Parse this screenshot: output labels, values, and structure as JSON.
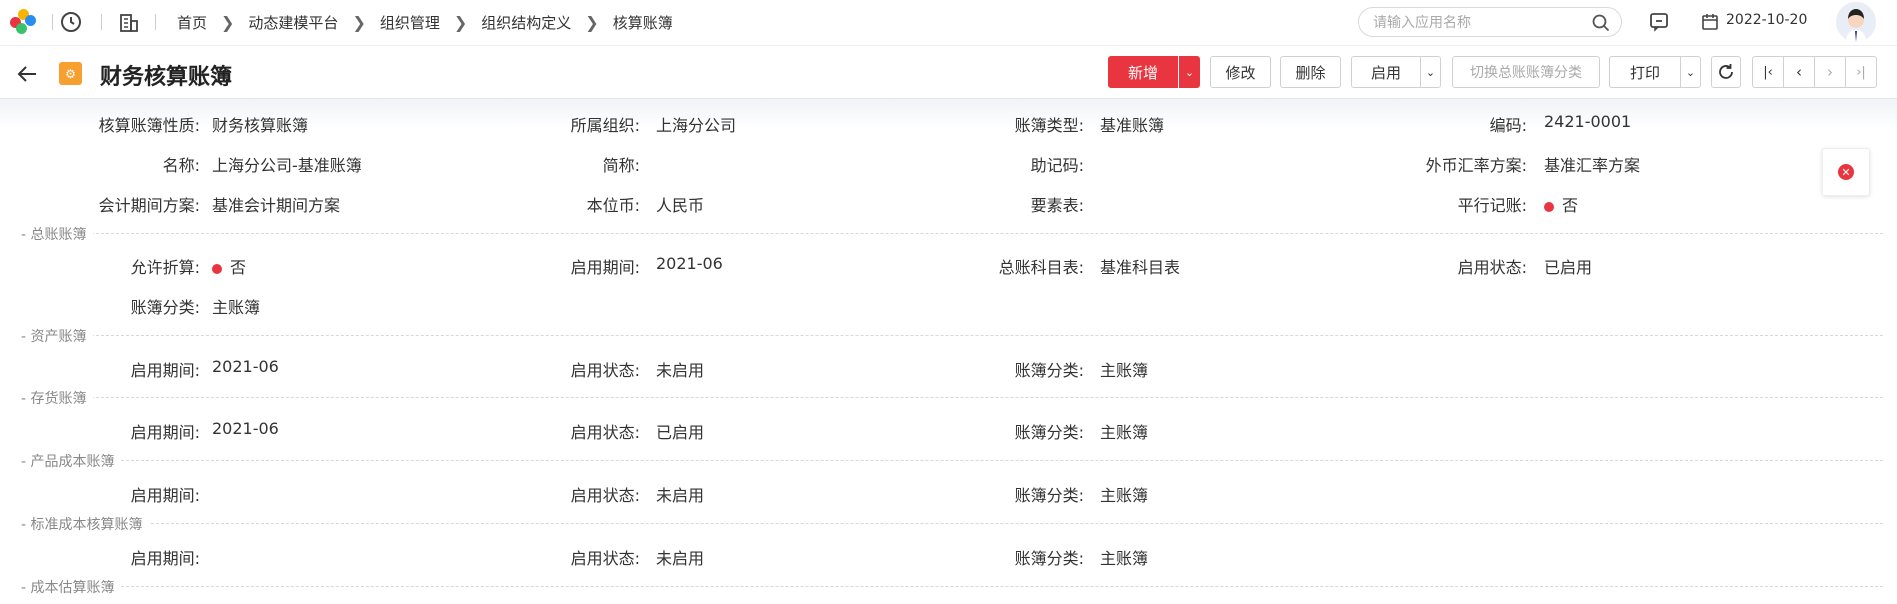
{
  "topbar": {
    "breadcrumb": [
      "首页",
      "动态建模平台",
      "组织管理",
      "组织结构定义",
      "核算账簿"
    ],
    "search_placeholder": "请输入应用名称",
    "date": "2022-10-20"
  },
  "header": {
    "title": "财务核算账簿",
    "buttons": {
      "add": "新增",
      "edit": "修改",
      "delete": "删除",
      "enable": "启用",
      "switch": "切换总账账簿分类",
      "print": "打印"
    }
  },
  "basic": {
    "r1": [
      {
        "label": "核算账簿性质:",
        "value": "财务核算账簿"
      },
      {
        "label": "所属组织:",
        "value": "上海分公司"
      },
      {
        "label": "账簿类型:",
        "value": "基准账簿"
      },
      {
        "label": "编码:",
        "value": "2421-0001"
      }
    ],
    "r2": [
      {
        "label": "名称:",
        "value": "上海分公司-基准账簿"
      },
      {
        "label": "简称:",
        "value": ""
      },
      {
        "label": "助记码:",
        "value": ""
      },
      {
        "label": "外币汇率方案:",
        "value": "基准汇率方案"
      }
    ],
    "r3": [
      {
        "label": "会计期间方案:",
        "value": "基准会计期间方案"
      },
      {
        "label": "本位币:",
        "value": "人民币"
      },
      {
        "label": "要素表:",
        "value": ""
      },
      {
        "label": "平行记账:",
        "value": "否"
      }
    ]
  },
  "sections": {
    "gl": {
      "title": "- 总账账簿",
      "r1": [
        {
          "label": "允许折算:",
          "value": "否"
        },
        {
          "label": "启用期间:",
          "value": "2021-06"
        },
        {
          "label": "总账科目表:",
          "value": "基准科目表"
        },
        {
          "label": "启用状态:",
          "value": "已启用"
        }
      ],
      "r2": [
        {
          "label": "账簿分类:",
          "value": "主账簿"
        }
      ]
    },
    "asset": {
      "title": "- 资产账簿",
      "r1": [
        {
          "label": "启用期间:",
          "value": "2021-06"
        },
        {
          "label": "启用状态:",
          "value": "未启用"
        },
        {
          "label": "账簿分类:",
          "value": "主账簿"
        }
      ]
    },
    "inventory": {
      "title": "- 存货账簿",
      "r1": [
        {
          "label": "启用期间:",
          "value": "2021-06"
        },
        {
          "label": "启用状态:",
          "value": "已启用"
        },
        {
          "label": "账簿分类:",
          "value": "主账簿"
        }
      ]
    },
    "product_cost": {
      "title": "- 产品成本账簿",
      "r1": [
        {
          "label": "启用期间:",
          "value": ""
        },
        {
          "label": "启用状态:",
          "value": "未启用"
        },
        {
          "label": "账簿分类:",
          "value": "主账簿"
        }
      ]
    },
    "std_cost": {
      "title": "- 标准成本核算账簿",
      "r1": [
        {
          "label": "启用期间:",
          "value": ""
        },
        {
          "label": "启用状态:",
          "value": "未启用"
        },
        {
          "label": "账簿分类:",
          "value": "主账簿"
        }
      ]
    },
    "cost_est": {
      "title": "- 成本估算账簿"
    }
  },
  "colors": {
    "primary": "#e8353f",
    "icon_orange": "#f7a030"
  }
}
